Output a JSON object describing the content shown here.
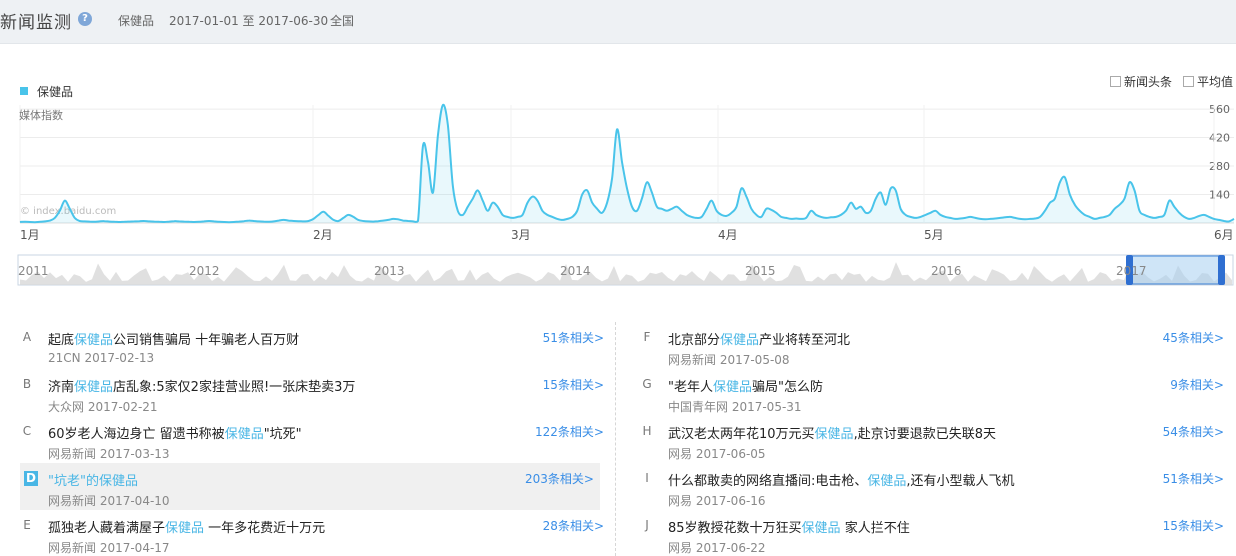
{
  "header": {
    "title": "新闻监测",
    "help_icon": "question-circle-icon",
    "keyword": "保健品",
    "date_range": "2017-01-01 至 2017-06-30",
    "region": "全国"
  },
  "legend": {
    "label": "保健品",
    "color": "#49c4ea"
  },
  "options": {
    "headline_label": "新闻头条",
    "average_label": "平均值"
  },
  "colors": {
    "accent": "#49b6e5",
    "link": "#3a8ee6"
  },
  "chart_data": {
    "type": "area",
    "series": [
      {
        "name": "保健品"
      }
    ],
    "ylabel": "媒体指数",
    "watermark": "© index.baidu.com",
    "y_ticks": [
      "560",
      "420",
      "280",
      "140"
    ],
    "ylim": [
      0,
      580
    ],
    "x_ticks": [
      "1月",
      "2月",
      "3月",
      "4月",
      "5月",
      "6月"
    ],
    "values": [
      5,
      6,
      5,
      4,
      6,
      8,
      12,
      25,
      60,
      110,
      70,
      25,
      10,
      8,
      7,
      6,
      8,
      9,
      7,
      6,
      5,
      6,
      7,
      8,
      9,
      10,
      8,
      7,
      6,
      5,
      7,
      9,
      8,
      7,
      6,
      5,
      6,
      8,
      10,
      8,
      6,
      5,
      4,
      5,
      7,
      9,
      12,
      10,
      8,
      7,
      6,
      8,
      12,
      15,
      12,
      10,
      9,
      8,
      10,
      20,
      40,
      55,
      35,
      15,
      10,
      25,
      40,
      30,
      15,
      10,
      8,
      7,
      9,
      12,
      15,
      20,
      18,
      12,
      10,
      8,
      10,
      380,
      300,
      150,
      430,
      580,
      480,
      180,
      60,
      40,
      80,
      120,
      160,
      110,
      60,
      100,
      80,
      40,
      30,
      25,
      30,
      40,
      100,
      130,
      110,
      60,
      40,
      30,
      20,
      15,
      20,
      30,
      60,
      140,
      160,
      100,
      70,
      50,
      100,
      220,
      460,
      300,
      170,
      80,
      60,
      120,
      200,
      150,
      80,
      70,
      60,
      70,
      80,
      60,
      40,
      30,
      25,
      30,
      70,
      110,
      60,
      40,
      35,
      50,
      80,
      170,
      130,
      70,
      40,
      30,
      70,
      65,
      50,
      30,
      25,
      20,
      22,
      20,
      25,
      60,
      40,
      30,
      25,
      28,
      30,
      40,
      60,
      100,
      70,
      80,
      50,
      60,
      120,
      150,
      90,
      170,
      160,
      70,
      40,
      30,
      25,
      30,
      40,
      50,
      60,
      40,
      30,
      25,
      20,
      22,
      25,
      30,
      25,
      20,
      18,
      20,
      22,
      25,
      28,
      30,
      25,
      20,
      18,
      20,
      22,
      30,
      60,
      100,
      120,
      200,
      225,
      140,
      90,
      60,
      40,
      30,
      20,
      25,
      30,
      40,
      70,
      90,
      120,
      200,
      160,
      60,
      40,
      30,
      25,
      30,
      40,
      110,
      80,
      50,
      30,
      20,
      25,
      35,
      40,
      30,
      20,
      15,
      10,
      8,
      20
    ]
  },
  "timeline": {
    "years": [
      "2011",
      "2012",
      "2013",
      "2014",
      "2015",
      "2016",
      "2017"
    ]
  },
  "news_left": [
    {
      "letter": "A",
      "pre": "起底",
      "kw": "保健品",
      "post": "公司销售骗局 十年骗老人百万财",
      "source": "21CN 2017-02-13",
      "related": "51条相关>"
    },
    {
      "letter": "B",
      "pre": "济南",
      "kw": "保健品",
      "post": "店乱象:5家仅2家挂营业照!一张床垫卖3万",
      "source": "大众网 2017-02-21",
      "related": "15条相关>"
    },
    {
      "letter": "C",
      "pre": "60岁老人海边身亡 留遗书称被",
      "kw": "保健品",
      "post": "\"坑死\"",
      "source": "网易新闻 2017-03-13",
      "related": "122条相关>"
    },
    {
      "letter": "D",
      "pre": "\"坑老\"的",
      "kw": "保健品",
      "post": "",
      "source": "网易新闻 2017-04-10",
      "related": "203条相关>"
    },
    {
      "letter": "E",
      "pre": "孤独老人藏着满屋子",
      "kw": "保健品",
      "post": " 一年多花费近十万元",
      "source": "网易新闻 2017-04-17",
      "related": "28条相关>"
    }
  ],
  "news_right": [
    {
      "letter": "F",
      "pre": "北京部分",
      "kw": "保健品",
      "post": "产业将转至河北",
      "source": "网易新闻 2017-05-08",
      "related": "45条相关>"
    },
    {
      "letter": "G",
      "pre": "\"老年人",
      "kw": "保健品",
      "post": "骗局\"怎么防",
      "source": "中国青年网 2017-05-31",
      "related": "9条相关>"
    },
    {
      "letter": "H",
      "pre": "武汉老太两年花10万元买",
      "kw": "保健品",
      "post": ",赴京讨要退款已失联8天",
      "source": "网易 2017-06-05",
      "related": "54条相关>"
    },
    {
      "letter": "I",
      "pre": "什么都敢卖的网络直播间:电击枪、",
      "kw": "保健品",
      "post": ",还有小型载人飞机",
      "source": "网易 2017-06-16",
      "related": "51条相关>"
    },
    {
      "letter": "J",
      "pre": "85岁教授花数十万狂买",
      "kw": "保健品",
      "post": " 家人拦不住",
      "source": "网易 2017-06-22",
      "related": "15条相关>"
    }
  ]
}
